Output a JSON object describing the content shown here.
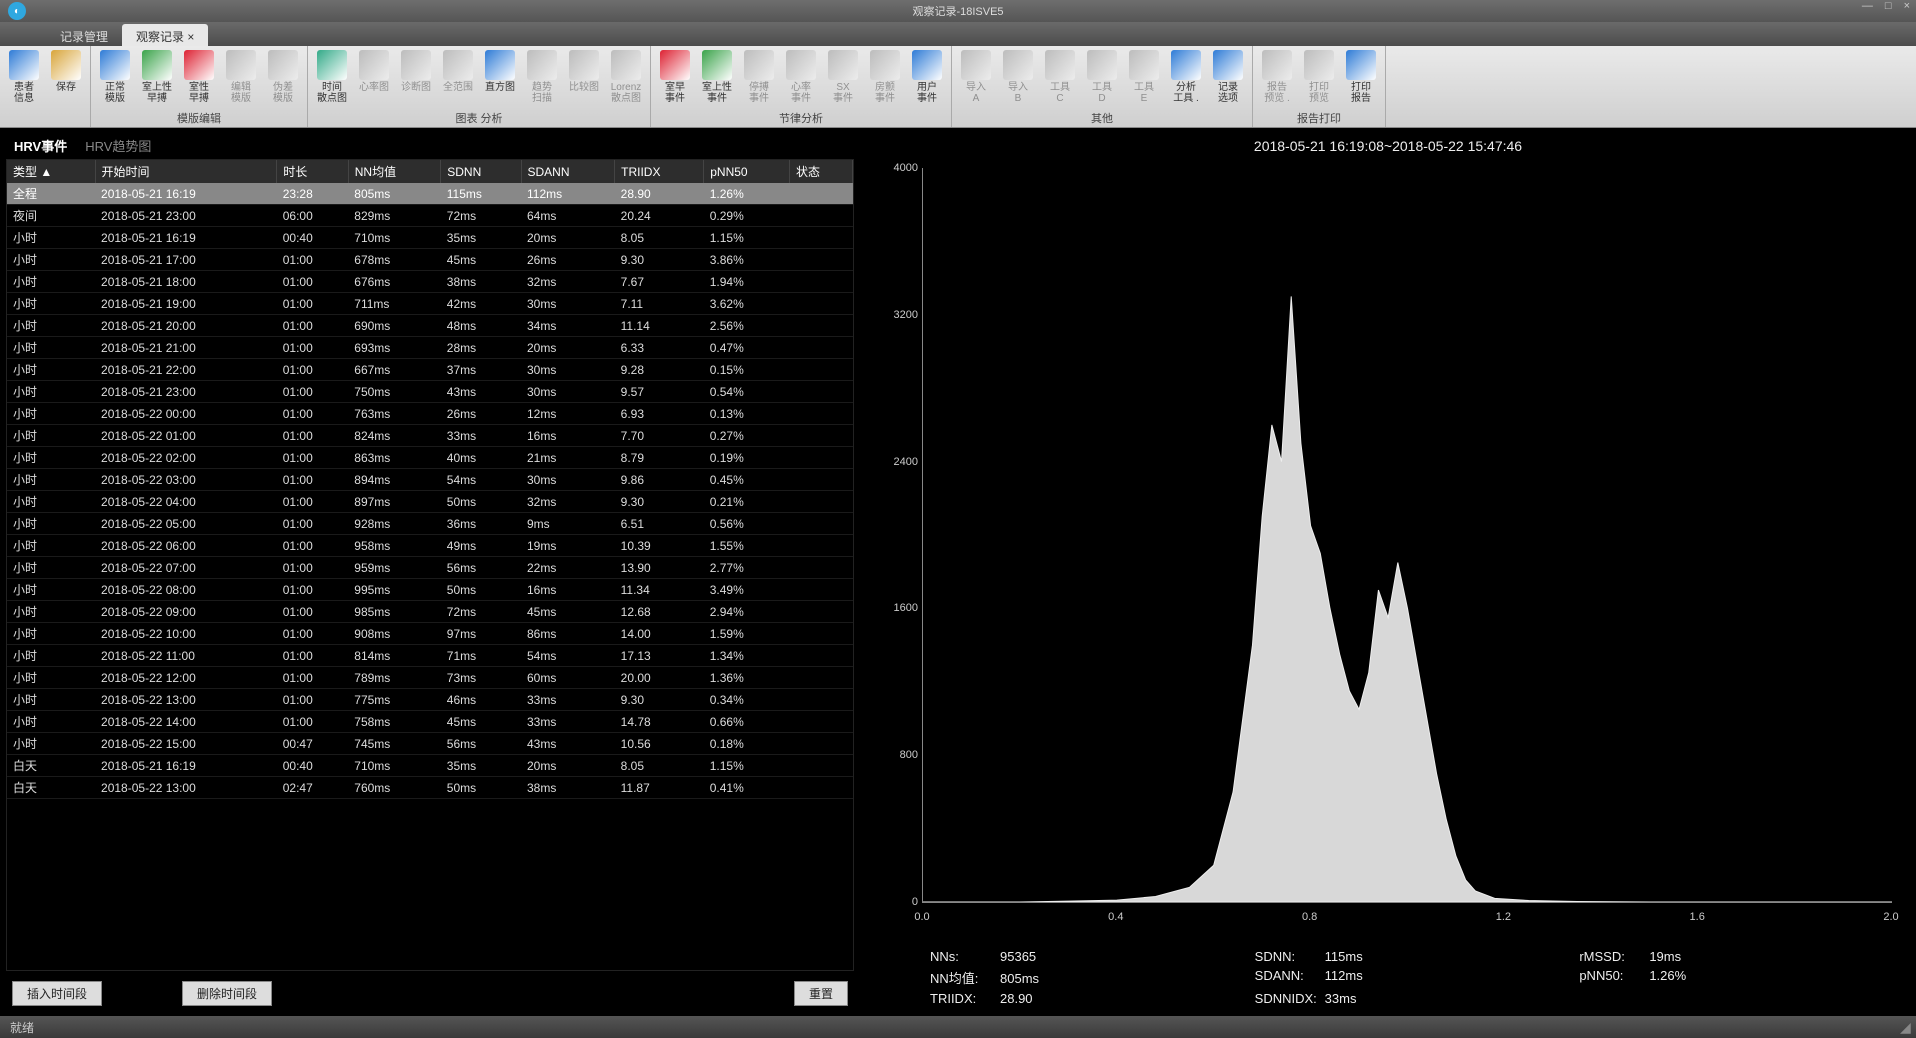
{
  "window": {
    "title": "观察记录-18ISVE5"
  },
  "main_tabs": [
    {
      "label": "记录管理"
    },
    {
      "label": "观察记录",
      "closable": true,
      "active": true
    }
  ],
  "ribbon_groups": [
    {
      "title": "",
      "items": [
        {
          "name": "patient-info",
          "label": "患者\n信息",
          "color": "#2e7bd6"
        },
        {
          "name": "save",
          "label": "保存",
          "color": "#d8a53a"
        }
      ]
    },
    {
      "title": "模版编辑",
      "items": [
        {
          "name": "normal-template",
          "label": "正常\n模版",
          "color": "#2e7bd6"
        },
        {
          "name": "sv-premature",
          "label": "室上性\n早搏",
          "color": "#3aa34a"
        },
        {
          "name": "v-premature",
          "label": "室性\n早搏",
          "color": "#d23"
        },
        {
          "name": "edit-template",
          "label": "编辑\n模版",
          "color": "#888",
          "dim": true
        },
        {
          "name": "artifact-template",
          "label": "伪差\n模版",
          "color": "#888",
          "dim": true
        }
      ]
    },
    {
      "title": "图表 分析",
      "items": [
        {
          "name": "time-scatter",
          "label": "时间\n散点图",
          "color": "#3a8"
        },
        {
          "name": "hr-chart",
          "label": "心率图",
          "color": "#888",
          "dim": true
        },
        {
          "name": "diag-chart",
          "label": "诊断图",
          "color": "#888",
          "dim": true
        },
        {
          "name": "full-range",
          "label": "全范围",
          "color": "#888",
          "dim": true
        },
        {
          "name": "histogram",
          "label": "直方图",
          "color": "#2e7bd6"
        },
        {
          "name": "trend-scan",
          "label": "趋势\n扫描",
          "color": "#888",
          "dim": true
        },
        {
          "name": "compare",
          "label": "比较图",
          "color": "#888",
          "dim": true
        },
        {
          "name": "lorenz",
          "label": "Lorenz\n散点图",
          "color": "#888",
          "dim": true
        }
      ]
    },
    {
      "title": "节律分析",
      "items": [
        {
          "name": "v-prem-event",
          "label": "室早\n事件",
          "color": "#d23"
        },
        {
          "name": "sv-event",
          "label": "室上性\n事件",
          "color": "#3aa34a"
        },
        {
          "name": "pause-event",
          "label": "停搏\n事件",
          "color": "#888",
          "dim": true
        },
        {
          "name": "hr-event",
          "label": "心率\n事件",
          "color": "#888",
          "dim": true
        },
        {
          "name": "sx-event",
          "label": "SX\n事件",
          "color": "#888",
          "dim": true
        },
        {
          "name": "af-event",
          "label": "房颤\n事件",
          "color": "#888",
          "dim": true
        },
        {
          "name": "user-event",
          "label": "用户\n事件",
          "color": "#2e7bd6"
        }
      ]
    },
    {
      "title": "其他",
      "items": [
        {
          "name": "import-a",
          "label": "导入\nA",
          "color": "#888",
          "dim": true
        },
        {
          "name": "import-b",
          "label": "导入\nB",
          "color": "#888",
          "dim": true
        },
        {
          "name": "tool-c",
          "label": "工具\nC",
          "color": "#888",
          "dim": true
        },
        {
          "name": "tool-d",
          "label": "工具\nD",
          "color": "#888",
          "dim": true
        },
        {
          "name": "tool-e",
          "label": "工具\nE",
          "color": "#888",
          "dim": true
        },
        {
          "name": "analysis-tool",
          "label": "分析\n工具 .",
          "color": "#2e7bd6"
        },
        {
          "name": "record-option",
          "label": "记录\n选项",
          "color": "#2e7bd6"
        }
      ]
    },
    {
      "title": "报告打印",
      "items": [
        {
          "name": "report-preview",
          "label": "报告\n预览 .",
          "color": "#888",
          "dim": true
        },
        {
          "name": "print-preview",
          "label": "打印\n预览",
          "color": "#888",
          "dim": true
        },
        {
          "name": "print-report",
          "label": "打印\n报告",
          "color": "#2e7bd6"
        }
      ]
    }
  ],
  "sub_tabs": [
    {
      "label": "HRV事件",
      "active": true
    },
    {
      "label": "HRV趋势图"
    }
  ],
  "table": {
    "headers": [
      "类型  ▲",
      "开始时间",
      "时长",
      "NN均值",
      "SDNN",
      "SDANN",
      "TRIIDX",
      "pNN50",
      "状态"
    ],
    "rows": [
      [
        "全程",
        "2018-05-21 16:19",
        "23:28",
        "805ms",
        "115ms",
        "112ms",
        "28.90",
        "1.26%",
        ""
      ],
      [
        "夜间",
        "2018-05-21 23:00",
        "06:00",
        "829ms",
        "72ms",
        "64ms",
        "20.24",
        "0.29%",
        ""
      ],
      [
        "小时",
        "2018-05-21 16:19",
        "00:40",
        "710ms",
        "35ms",
        "20ms",
        "8.05",
        "1.15%",
        ""
      ],
      [
        "小时",
        "2018-05-21 17:00",
        "01:00",
        "678ms",
        "45ms",
        "26ms",
        "9.30",
        "3.86%",
        ""
      ],
      [
        "小时",
        "2018-05-21 18:00",
        "01:00",
        "676ms",
        "38ms",
        "32ms",
        "7.67",
        "1.94%",
        ""
      ],
      [
        "小时",
        "2018-05-21 19:00",
        "01:00",
        "711ms",
        "42ms",
        "30ms",
        "7.11",
        "3.62%",
        ""
      ],
      [
        "小时",
        "2018-05-21 20:00",
        "01:00",
        "690ms",
        "48ms",
        "34ms",
        "11.14",
        "2.56%",
        ""
      ],
      [
        "小时",
        "2018-05-21 21:00",
        "01:00",
        "693ms",
        "28ms",
        "20ms",
        "6.33",
        "0.47%",
        ""
      ],
      [
        "小时",
        "2018-05-21 22:00",
        "01:00",
        "667ms",
        "37ms",
        "30ms",
        "9.28",
        "0.15%",
        ""
      ],
      [
        "小时",
        "2018-05-21 23:00",
        "01:00",
        "750ms",
        "43ms",
        "30ms",
        "9.57",
        "0.54%",
        ""
      ],
      [
        "小时",
        "2018-05-22 00:00",
        "01:00",
        "763ms",
        "26ms",
        "12ms",
        "6.93",
        "0.13%",
        ""
      ],
      [
        "小时",
        "2018-05-22 01:00",
        "01:00",
        "824ms",
        "33ms",
        "16ms",
        "7.70",
        "0.27%",
        ""
      ],
      [
        "小时",
        "2018-05-22 02:00",
        "01:00",
        "863ms",
        "40ms",
        "21ms",
        "8.79",
        "0.19%",
        ""
      ],
      [
        "小时",
        "2018-05-22 03:00",
        "01:00",
        "894ms",
        "54ms",
        "30ms",
        "9.86",
        "0.45%",
        ""
      ],
      [
        "小时",
        "2018-05-22 04:00",
        "01:00",
        "897ms",
        "50ms",
        "32ms",
        "9.30",
        "0.21%",
        ""
      ],
      [
        "小时",
        "2018-05-22 05:00",
        "01:00",
        "928ms",
        "36ms",
        "9ms",
        "6.51",
        "0.56%",
        ""
      ],
      [
        "小时",
        "2018-05-22 06:00",
        "01:00",
        "958ms",
        "49ms",
        "19ms",
        "10.39",
        "1.55%",
        ""
      ],
      [
        "小时",
        "2018-05-22 07:00",
        "01:00",
        "959ms",
        "56ms",
        "22ms",
        "13.90",
        "2.77%",
        ""
      ],
      [
        "小时",
        "2018-05-22 08:00",
        "01:00",
        "995ms",
        "50ms",
        "16ms",
        "11.34",
        "3.49%",
        ""
      ],
      [
        "小时",
        "2018-05-22 09:00",
        "01:00",
        "985ms",
        "72ms",
        "45ms",
        "12.68",
        "2.94%",
        ""
      ],
      [
        "小时",
        "2018-05-22 10:00",
        "01:00",
        "908ms",
        "97ms",
        "86ms",
        "14.00",
        "1.59%",
        ""
      ],
      [
        "小时",
        "2018-05-22 11:00",
        "01:00",
        "814ms",
        "71ms",
        "54ms",
        "17.13",
        "1.34%",
        ""
      ],
      [
        "小时",
        "2018-05-22 12:00",
        "01:00",
        "789ms",
        "73ms",
        "60ms",
        "20.00",
        "1.36%",
        ""
      ],
      [
        "小时",
        "2018-05-22 13:00",
        "01:00",
        "775ms",
        "46ms",
        "33ms",
        "9.30",
        "0.34%",
        ""
      ],
      [
        "小时",
        "2018-05-22 14:00",
        "01:00",
        "758ms",
        "45ms",
        "33ms",
        "14.78",
        "0.66%",
        ""
      ],
      [
        "小时",
        "2018-05-22 15:00",
        "00:47",
        "745ms",
        "56ms",
        "43ms",
        "10.56",
        "0.18%",
        ""
      ],
      [
        "白天",
        "2018-05-21 16:19",
        "00:40",
        "710ms",
        "35ms",
        "20ms",
        "8.05",
        "1.15%",
        ""
      ],
      [
        "白天",
        "2018-05-22 13:00",
        "02:47",
        "760ms",
        "50ms",
        "38ms",
        "11.87",
        "0.41%",
        ""
      ]
    ]
  },
  "buttons": {
    "insert": "插入时间段",
    "delete": "删除时间段",
    "reset": "重置"
  },
  "chart_title": "2018-05-21 16:19:08~2018-05-22 15:47:46",
  "stats": [
    {
      "label": "NNs:",
      "value": "95365"
    },
    {
      "label": "SDNN:",
      "value": "115ms"
    },
    {
      "label": "rMSSD:",
      "value": "19ms"
    },
    {
      "label": "NN均值:",
      "value": "805ms"
    },
    {
      "label": "SDANN:",
      "value": "112ms"
    },
    {
      "label": "pNN50:",
      "value": "1.26%"
    },
    {
      "label": "TRIIDX:",
      "value": "28.90"
    },
    {
      "label": "SDNNIDX:",
      "value": "33ms"
    },
    {
      "label": "",
      "value": ""
    }
  ],
  "status": "就绪",
  "chart_data": {
    "type": "area",
    "title": "2018-05-21 16:19:08~2018-05-22 15:47:46",
    "xlabel": "",
    "ylabel": "",
    "xlim": [
      0.0,
      2.0
    ],
    "ylim": [
      0,
      4000
    ],
    "xticks": [
      0.0,
      0.4,
      0.8,
      1.2,
      1.6,
      2.0
    ],
    "yticks": [
      0,
      800,
      1600,
      2400,
      3200,
      4000
    ],
    "x": [
      0.0,
      0.2,
      0.3,
      0.4,
      0.48,
      0.55,
      0.6,
      0.64,
      0.68,
      0.7,
      0.72,
      0.74,
      0.76,
      0.78,
      0.8,
      0.82,
      0.84,
      0.86,
      0.88,
      0.9,
      0.92,
      0.94,
      0.96,
      0.98,
      1.0,
      1.02,
      1.04,
      1.06,
      1.08,
      1.1,
      1.12,
      1.14,
      1.18,
      1.25,
      1.35,
      1.5,
      1.7,
      2.0
    ],
    "y": [
      0,
      0,
      5,
      10,
      30,
      80,
      200,
      600,
      1400,
      2100,
      2600,
      2400,
      3300,
      2500,
      2050,
      1900,
      1600,
      1350,
      1150,
      1050,
      1250,
      1700,
      1550,
      1850,
      1600,
      1300,
      1000,
      700,
      450,
      250,
      120,
      60,
      20,
      8,
      3,
      0,
      0,
      0
    ]
  }
}
